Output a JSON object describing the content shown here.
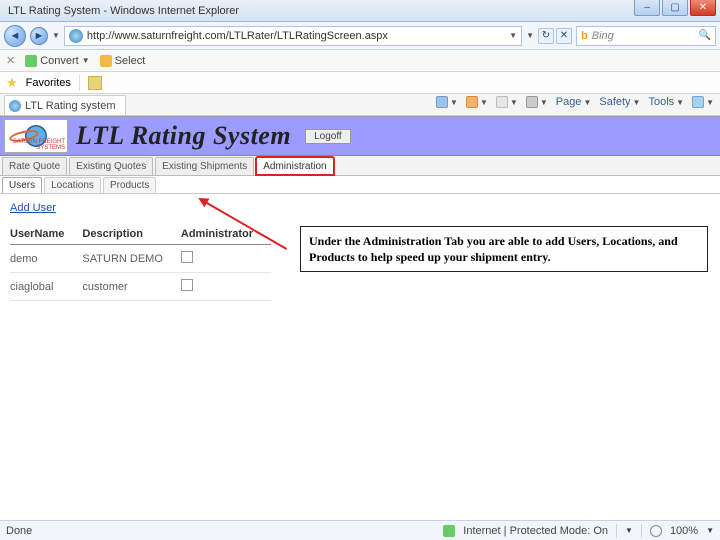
{
  "window": {
    "title": "LTL Rating System - Windows Internet Explorer"
  },
  "nav": {
    "url": "http://www.saturnfreight.com/LTLRater/LTLRatingScreen.aspx",
    "search_provider": "Bing",
    "search_placeholder": "Bing"
  },
  "toolbar_convert": {
    "convert": "Convert",
    "select": "Select"
  },
  "favorites": {
    "label": "Favorites"
  },
  "page_tab": {
    "label": "LTL Rating system"
  },
  "tab_tools": {
    "page": "Page",
    "safety": "Safety",
    "tools": "Tools"
  },
  "banner": {
    "title": "LTL Rating System",
    "logoff": "Logoff",
    "logo_text": "SATURN FREIGHT SYSTEMS"
  },
  "main_tabs": {
    "rate_quote": "Rate Quote",
    "existing_quotes": "Existing Quotes",
    "existing_shipments": "Existing Shipments",
    "administration": "Administration"
  },
  "sub_tabs": {
    "users": "Users",
    "locations": "Locations",
    "products": "Products"
  },
  "users_section": {
    "add_user": "Add User",
    "headers": {
      "username": "UserName",
      "description": "Description",
      "administrator": "Administrator"
    },
    "rows": [
      {
        "username": "demo",
        "description": "SATURN DEMO",
        "administrator": false
      },
      {
        "username": "ciaglobal",
        "description": "customer",
        "administrator": false
      }
    ]
  },
  "callout": {
    "text": "Under the Administration Tab you are able to add Users, Locations, and Products to help speed up your shipment entry."
  },
  "status": {
    "done": "Done",
    "zone": "Internet | Protected Mode: On",
    "zoom": "100%"
  }
}
